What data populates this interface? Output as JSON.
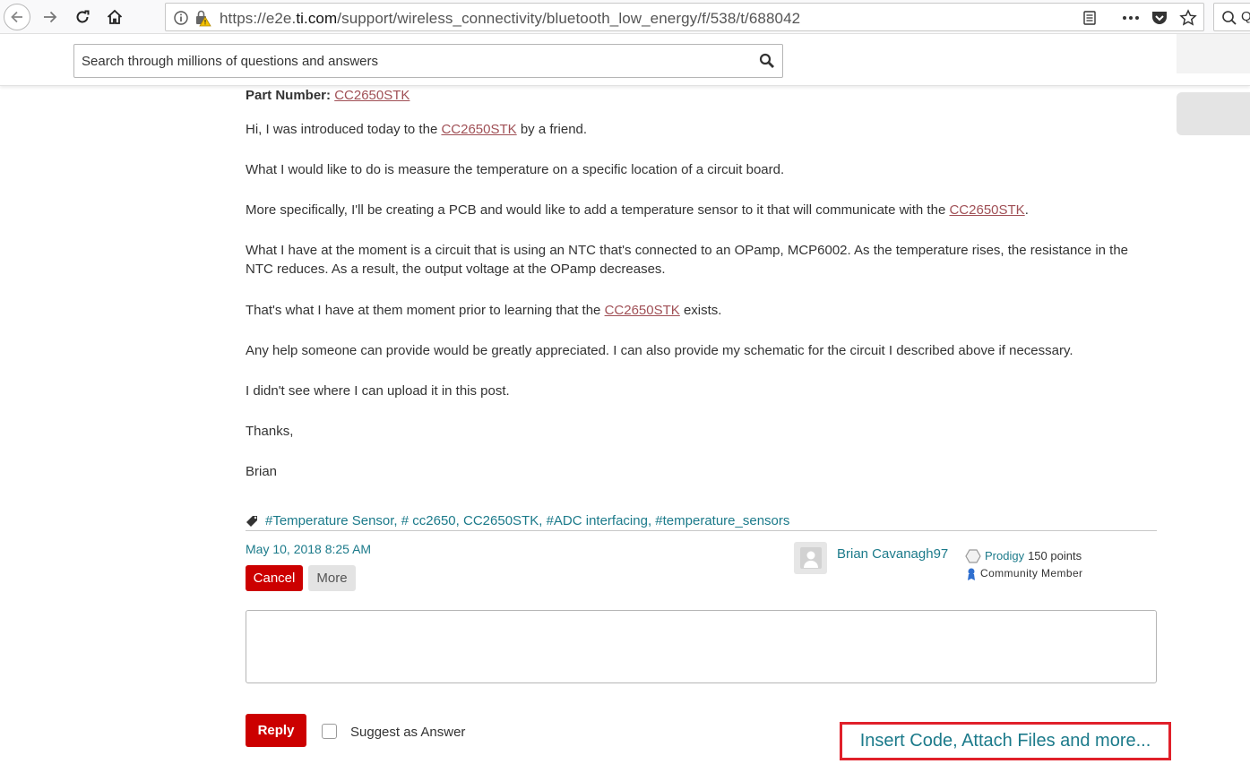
{
  "browser": {
    "url_prefix": "https://e2e.",
    "url_domain": "ti.com",
    "url_path": "/support/wireless_connectivity/bluetooth_low_energy/f/538/t/688042",
    "side_search_text": "Q"
  },
  "header": {
    "search_placeholder": "Search through millions of questions and answers"
  },
  "post": {
    "part_label": "Part Number:",
    "part_number": "CC2650STK",
    "p1_before": "Hi, I was introduced today to the ",
    "p1_link": "CC2650STK",
    "p1_after": " by a friend.",
    "p2": "What I would like to do is measure the temperature on a specific location of a circuit board.",
    "p3_before": "More specifically, I'll be creating a PCB and would like to add a temperature sensor to it that will communicate with the ",
    "p3_link": "CC2650STK",
    "p3_after": ".",
    "p4": "What I have at the moment is a circuit that is using an NTC that's connected to an OPamp, MCP6002.  As the temperature rises, the resistance in the NTC reduces.  As a result, the output voltage at the OPamp decreases.",
    "p5_before": "That's what I have at them moment prior to learning that the ",
    "p5_link": "CC2650STK",
    "p5_after": " exists.",
    "p6": "Any help someone can provide would be greatly appreciated.  I can also provide my schematic for the circuit I described above if necessary.",
    "p7": "I didn't see where I can upload it in this post.",
    "p8": "Thanks,",
    "p9": "Brian",
    "tags": [
      "#Temperature Sensor",
      "# cc2650",
      "CC2650STK",
      "#ADC interfacing",
      "#temperature_sensors"
    ],
    "tag_separator": ", "
  },
  "meta": {
    "date": "May 10, 2018 8:25 AM",
    "cancel_label": "Cancel",
    "more_label": "More",
    "author": "Brian Cavanagh97",
    "rank": "Prodigy",
    "points": "150 points",
    "member_type": "Community Member"
  },
  "reply": {
    "reply_label": "Reply",
    "suggest_label": "Suggest as Answer",
    "insert_label": "Insert Code, Attach Files and more..."
  },
  "colors": {
    "accent_red": "#cc0000",
    "link_teal": "#1b7a8a",
    "highlight_border": "#e0202a"
  }
}
